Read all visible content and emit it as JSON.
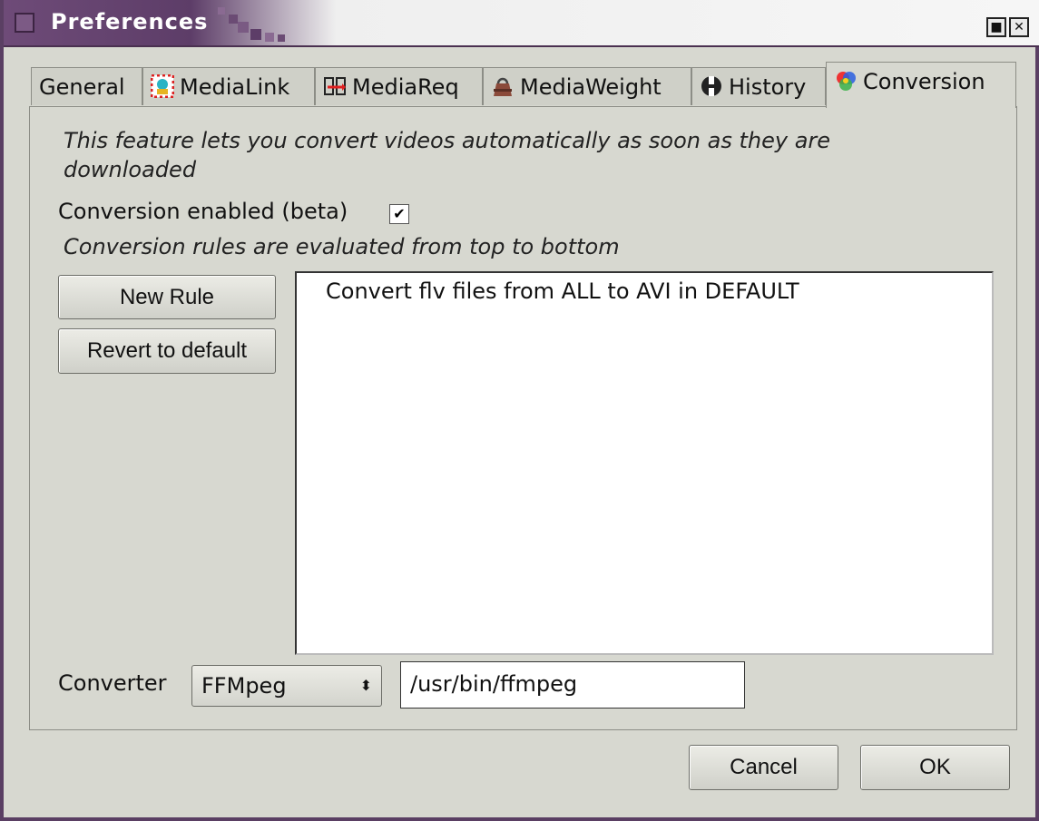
{
  "window": {
    "title": "Preferences",
    "minimize_glyph": "■",
    "close_glyph": "✕"
  },
  "tabs": [
    {
      "label": "General",
      "icon": ""
    },
    {
      "label": "MediaLink",
      "icon": "medialink-icon"
    },
    {
      "label": "MediaReq",
      "icon": "mediareq-icon"
    },
    {
      "label": "MediaWeight",
      "icon": "weight-icon"
    },
    {
      "label": "History",
      "icon": "history-icon"
    },
    {
      "label": "Conversion",
      "icon": "conversion-icon",
      "active": true
    }
  ],
  "conversion": {
    "description": "This feature lets you convert videos automatically as soon as they are downloaded",
    "enabled_label": "Conversion enabled (beta)",
    "enabled_checked": true,
    "check_glyph": "✔",
    "rules_note": "Conversion rules are evaluated from top to bottom",
    "new_rule_label": "New Rule",
    "revert_label": "Revert to default",
    "rules": [
      "Convert flv files from ALL to AVI in DEFAULT"
    ],
    "converter_label": "Converter",
    "converter_selected": "FFMpeg",
    "select_arrow": "⬍",
    "converter_path": "/usr/bin/ffmpeg"
  },
  "footer": {
    "cancel_label": "Cancel",
    "ok_label": "OK"
  },
  "colors": {
    "titlebar": "#5d3d68",
    "background": "#d7d8d0"
  }
}
